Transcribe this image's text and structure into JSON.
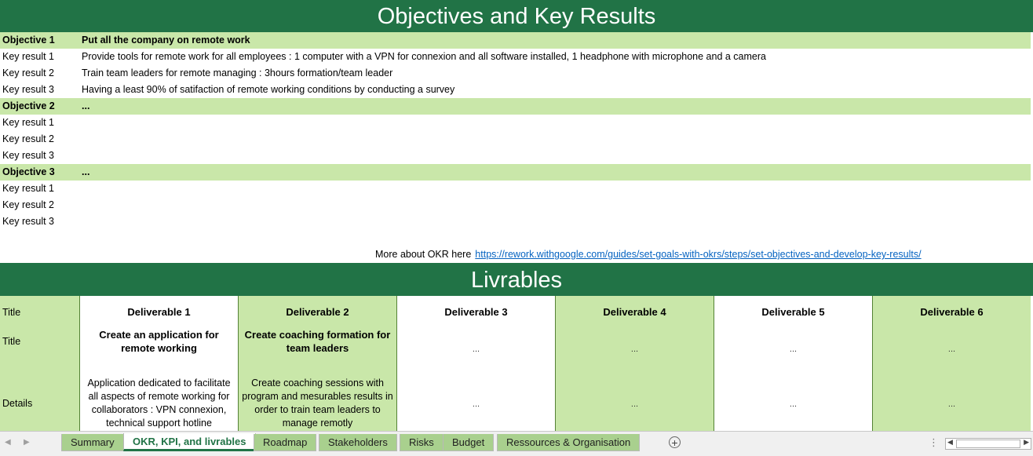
{
  "okr": {
    "title": "Objectives and Key Results",
    "objectives": [
      {
        "label": "Objective 1",
        "text": "Put all the company on remote work",
        "key_results": [
          {
            "label": "Key result 1",
            "text": "Provide tools for remote work for all employees : 1 computer with a VPN for connexion and all software installed, 1 headphone with microphone and a camera"
          },
          {
            "label": "Key result 2",
            "text": "Train team leaders for remote managing : 3hours formation/team leader"
          },
          {
            "label": "Key result 3",
            "text": "Having a least 90% of satifaction of remote working conditions by conducting a survey"
          }
        ]
      },
      {
        "label": "Objective 2",
        "text": "...",
        "key_results": [
          {
            "label": "Key result 1",
            "text": ""
          },
          {
            "label": "Key result 2",
            "text": ""
          },
          {
            "label": "Key result 3",
            "text": ""
          }
        ]
      },
      {
        "label": "Objective 3",
        "text": "...",
        "key_results": [
          {
            "label": "Key result 1",
            "text": ""
          },
          {
            "label": "Key result 2",
            "text": ""
          },
          {
            "label": "Key result 3",
            "text": ""
          }
        ]
      }
    ],
    "more_label": "More about OKR here",
    "more_link": "https://rework.withgoogle.com/guides/set-goals-with-okrs/steps/set-objectives-and-develop-key-results/"
  },
  "livrables": {
    "title": "Livrables",
    "row_labels": [
      "Title",
      "Title",
      "Details"
    ],
    "columns": [
      {
        "header": "Deliverable 1",
        "name": "Create an application for remote working",
        "details": "Application dedicated to facilitate all aspects of remote working for collaborators : VPN connexion, technical support hotline"
      },
      {
        "header": "Deliverable 2",
        "name": "Create coaching formation for team leaders",
        "details": "Create coaching sessions with program and mesurables results in order to train team leaders to manage remotly"
      },
      {
        "header": "Deliverable 3",
        "name": "...",
        "details": "..."
      },
      {
        "header": "Deliverable 4",
        "name": "...",
        "details": "..."
      },
      {
        "header": "Deliverable 5",
        "name": "...",
        "details": "..."
      },
      {
        "header": "Deliverable 6",
        "name": "...",
        "details": "..."
      }
    ]
  },
  "tabs": [
    {
      "label": "Summary",
      "active": false
    },
    {
      "label": "OKR, KPI, and livrables",
      "active": true
    },
    {
      "label": "Roadmap",
      "active": false
    },
    {
      "label": "Stakeholders",
      "active": false
    },
    {
      "label": "Risks",
      "active": false
    },
    {
      "label": "Budget",
      "active": false
    },
    {
      "label": "Ressources & Organisation",
      "active": false
    }
  ],
  "icons": {
    "add_sheet": "plus-circle-icon",
    "nav_prev": "triangle-left-icon",
    "nav_next": "triangle-right-icon",
    "options": "vertical-dots-icon"
  },
  "colors": {
    "header_green": "#217346",
    "row_green": "#c9e7a9",
    "tab_green": "#a9d08e",
    "link_blue": "#0563c1"
  }
}
